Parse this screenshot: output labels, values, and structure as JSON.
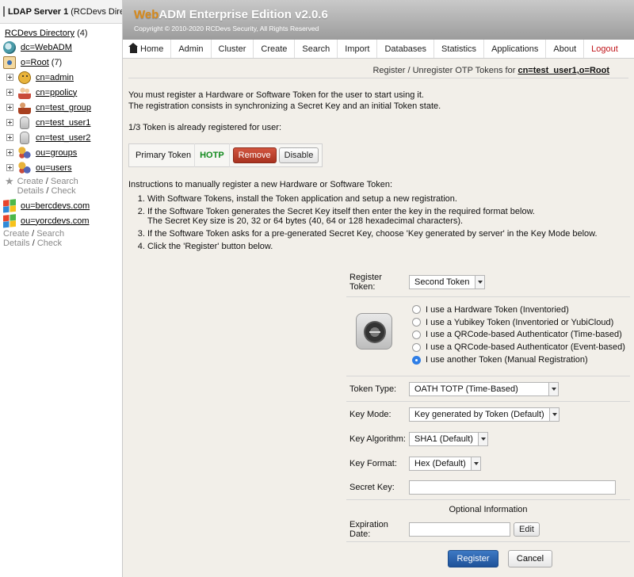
{
  "sidebar": {
    "server_title": "LDAP Server 1",
    "server_subtitle": "(RCDevs Directory)",
    "root_label": "RCDevs Directory",
    "root_count": "(4)",
    "items": [
      {
        "label": "dc=WebADM",
        "icon": "globe-icon"
      },
      {
        "label": "o=Root",
        "count": "(7)",
        "icon": "organization-icon"
      },
      {
        "label": "cn=admin",
        "icon": "smiley-user-icon"
      },
      {
        "label": "cn=ppolicy",
        "icon": "people-icon"
      },
      {
        "label": "cn=test_group",
        "icon": "group-icon"
      },
      {
        "label": "cn=test_user1",
        "icon": "user-icon"
      },
      {
        "label": "cn=test_user2",
        "icon": "user-icon"
      },
      {
        "label": "ou=groups",
        "icon": "ou-icon"
      },
      {
        "label": "ou=users",
        "icon": "ou-icon"
      }
    ],
    "create_label": "Create",
    "search_label": "Search",
    "details_label": "Details",
    "check_label": "Check",
    "domains": [
      {
        "label": "ou=bercdevs.com",
        "icon": "windows-icon"
      },
      {
        "label": "ou=yorcdevs.com",
        "icon": "windows-icon"
      }
    ]
  },
  "header": {
    "brand_web": "Web",
    "brand_adm": "ADM",
    "edition": "Enterprise Edition v2.0.6",
    "copyright": "Copyright © 2010-2020 RCDevs Security, All Rights Reserved"
  },
  "nav": [
    "Home",
    "Admin",
    "Cluster",
    "Create",
    "Search",
    "Import",
    "Databases",
    "Statistics",
    "Applications",
    "About",
    "Logout"
  ],
  "main": {
    "crumb_prefix": "Register / Unregister OTP Tokens for",
    "crumb_target": "cn=test_user1,o=Root",
    "intro1": "You must register a Hardware or Software Token for the user to start using it.",
    "intro2": "The registration consists in synchronizing a Secret Key and an initial Token state.",
    "status": "1/3 Token is already registered for user:",
    "token_label": "Primary Token",
    "token_type": "HOTP",
    "remove_label": "Remove",
    "disable_label": "Disable",
    "instructions": "Instructions to manually register a new Hardware or Software Token:",
    "steps": [
      "With Software Tokens, install the Token application and setup a new registration.",
      "If the Software Token generates the Secret Key itself then enter the key in the required format below.",
      "The Secret Key size is 20, 32 or 64 bytes (40, 64 or 128 hexadecimal characters).",
      "If the Software Token asks for a pre-generated Secret Key, choose 'Key generated by server' in the Key Mode below.",
      "Click the 'Register' button below."
    ]
  },
  "form": {
    "register_token_label": "Register Token:",
    "register_token_value": "Second Token",
    "radios": [
      {
        "label": "I use a Hardware Token (Inventoried)",
        "checked": false
      },
      {
        "label": "I use a Yubikey Token (Inventoried or YubiCloud)",
        "checked": false
      },
      {
        "label": "I use a QRCode-based Authenticator (Time-based)",
        "checked": false
      },
      {
        "label": "I use a QRCode-based Authenticator (Event-based)",
        "checked": false
      },
      {
        "label": "I use another Token (Manual Registration)",
        "checked": true
      }
    ],
    "token_type_label": "Token Type:",
    "token_type_value": "OATH TOTP (Time-Based)",
    "key_mode_label": "Key Mode:",
    "key_mode_value": "Key generated by Token (Default)",
    "key_algorithm_label": "Key Algorithm:",
    "key_algorithm_value": "SHA1 (Default)",
    "key_format_label": "Key Format:",
    "key_format_value": "Hex (Default)",
    "secret_key_label": "Secret Key:",
    "secret_key_value": "",
    "optional_label": "Optional Information",
    "expiration_label": "Expiration Date:",
    "expiration_value": "",
    "edit_label": "Edit",
    "register_label": "Register",
    "cancel_label": "Cancel"
  }
}
